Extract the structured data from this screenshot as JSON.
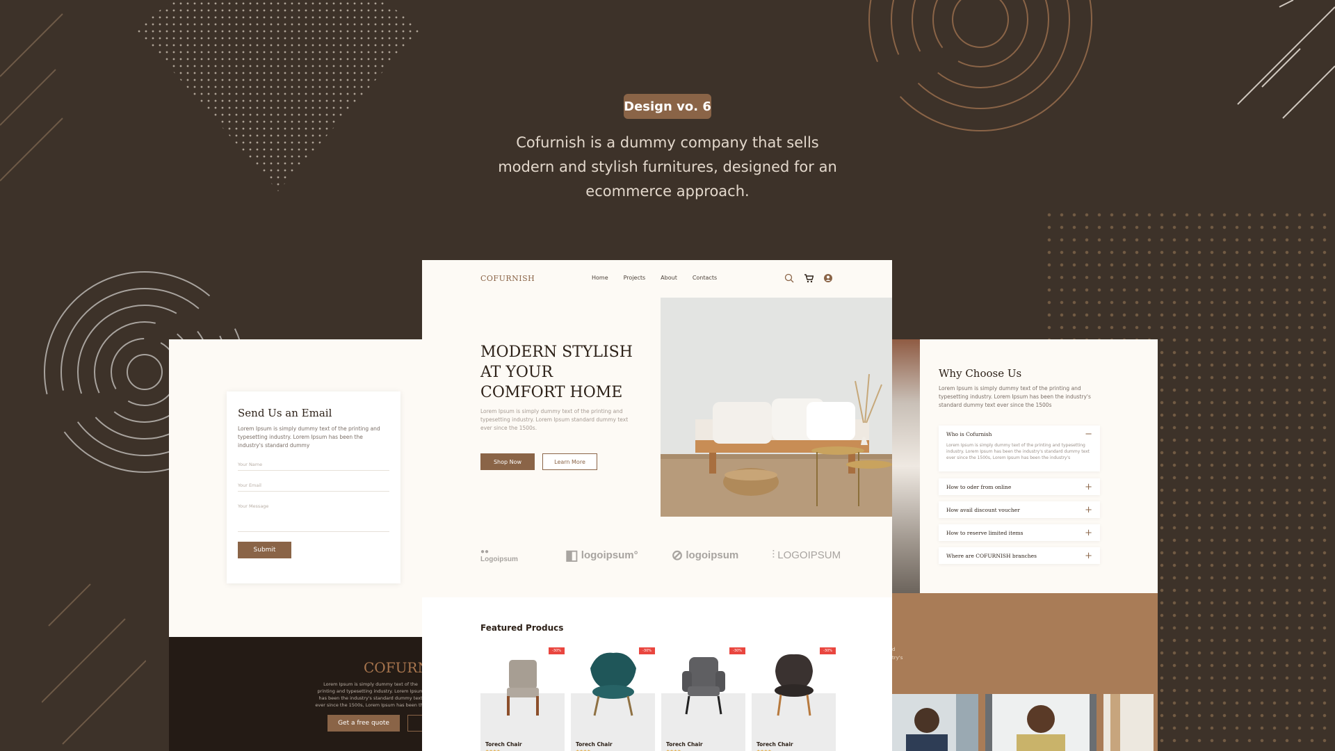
{
  "badge": "Design vo. 6",
  "tagline": "Cofurnish is a dummy company that sells modern and stylish furnitures, designed for an ecommerce approach.",
  "colors": {
    "background": "#3d3229",
    "accent": "#8a6447",
    "paper": "#fdfaf5",
    "sale": "#e9463f"
  },
  "left_mock": {
    "email_title": "Send Us an Email",
    "email_text": "Lorem Ipsum is simply dummy text of the printing and typesetting industry. Lorem Ipsum has been the industry's standard dummy",
    "name_placeholder": "Your Name",
    "email_placeholder": "Your Email",
    "message_placeholder": "Your Message",
    "submit": "Submit",
    "footer_logo": "COFURN",
    "footer_text": "Lorem Ipsum is simply dummy text of the printing and typesetting industry. Lorem Ipsum has been the industry's standard dummy text ever since the 1500s, Lorem Ipsum has been the",
    "quote_button": "Get a free quote"
  },
  "center_mock": {
    "logo": "COFURNISH",
    "nav": [
      "Home",
      "Projects",
      "About",
      "Contacts"
    ],
    "icons": [
      "search-icon",
      "cart-icon",
      "user-icon"
    ],
    "hero_title": "MODERN STYLISH AT YOUR COMFORT HOME",
    "hero_sub": "Lorem Ipsum is simply dummy text of the printing and typesetting industry. Lorem Ipsum standard dummy text ever since the 1500s.",
    "shop_now": "Shop Now",
    "learn_more": "Learn More",
    "brands": [
      "Logoipsum",
      "logoipsum°",
      "logoipsum",
      "LOGOIPSUM"
    ],
    "featured_title": "Featured Producs",
    "products": [
      {
        "name": "Torech Chair",
        "sale": "-30%",
        "stars": "★★★★"
      },
      {
        "name": "Torech Chair",
        "sale": "-30%",
        "stars": "★★★★"
      },
      {
        "name": "Torech Chair",
        "sale": "-30%",
        "stars": "★★★★"
      },
      {
        "name": "Torech Chair",
        "sale": "-30%",
        "stars": "★★★★"
      }
    ]
  },
  "right_mock": {
    "why_title": "Why Choose Us",
    "why_text": "Lorem Ipsum is simply dummy text of the printing and typesetting industry. Lorem Ipsum has been the industry's standard dummy text ever since the 1500s",
    "faq": [
      {
        "q": "Who is Cofurnish",
        "a": "Lorem Ipsum is simply dummy text of the printing and typesetting industry. Lorem Ipsum has been the industry's standard dummy text ever since the 1500s, Lorem Ipsum has been the industry's",
        "open": true
      },
      {
        "q": "How to oder from online",
        "open": false
      },
      {
        "q": "How avail discount voucher",
        "open": false
      },
      {
        "q": "How to reserve limited items",
        "open": false
      },
      {
        "q": "Where are COFURNISH branches",
        "open": false
      }
    ],
    "partial_text": "d\ntry's"
  }
}
